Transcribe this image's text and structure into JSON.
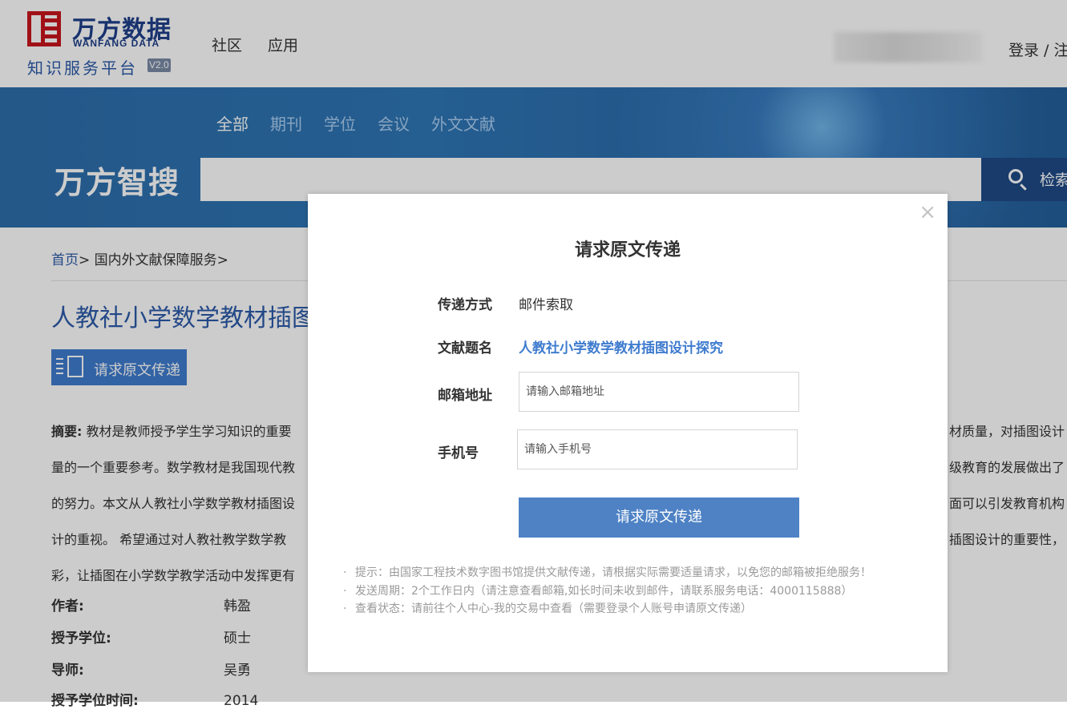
{
  "header": {
    "logo": {
      "cn": "万方数据",
      "en": "WANFANG DATA",
      "sub": "知识服务平台",
      "version": "V2.0"
    },
    "nav": [
      "社区",
      "应用"
    ],
    "login": "登录 / 注"
  },
  "banner": {
    "tabs": [
      "全部",
      "期刊",
      "学位",
      "会议",
      "外文文献"
    ],
    "brand": "万方智搜",
    "search_placeholder": "",
    "search_button": "检索"
  },
  "page": {
    "breadcrumb": {
      "home": "首页",
      "rest": "> 国内外文献保障服务>"
    },
    "title": "人教社小学数学教材插图",
    "request_button": "请求原文传递",
    "abstract": {
      "label": "摘要:",
      "lines": [
        "教材是教师授予学生学习知识的重要",
        "量的一个重要参考。数学教材是我国现代教",
        "的努力。本文从人教社小学数学教材插图设",
        "计的重视。 希望通过对人教社教学数学教",
        "彩，让插图在小学数学教学活动中发挥更有"
      ],
      "right_fragments": [
        "材质量，对插图设计",
        "级教育的发展做出了",
        "面可以引发教育机构",
        "插图设计的重要性，",
        ""
      ]
    },
    "meta": [
      {
        "key": "作者:",
        "value": "韩盈"
      },
      {
        "key": "授予学位:",
        "value": "硕士"
      },
      {
        "key": "导师:",
        "value": "吴勇"
      },
      {
        "key": "授予学位时间:",
        "value": "2014"
      }
    ]
  },
  "modal": {
    "close": "×",
    "title": "请求原文传递",
    "delivery_label": "传递方式",
    "delivery_value": "邮件索取",
    "doc_title_label": "文献题名",
    "doc_title_value": "人教社小学数学教材插图设计探究",
    "email_label": "邮箱地址",
    "email_placeholder": "请输入邮箱地址",
    "phone_label": "手机号",
    "phone_placeholder": "请输入手机号",
    "submit": "请求原文传递",
    "tips": [
      "提示：由国家工程技术数字图书馆提供文献传递，请根据实际需要适量请求，以免您的邮箱被拒绝服务！",
      "发送周期：2个工作日内（请注意查看邮箱,如长时间未收到邮件，请联系服务电话：4000115888）",
      "查看状态：请前往个人中心-我的交易中查看（需要登录个人账号申请原文传递）"
    ]
  }
}
